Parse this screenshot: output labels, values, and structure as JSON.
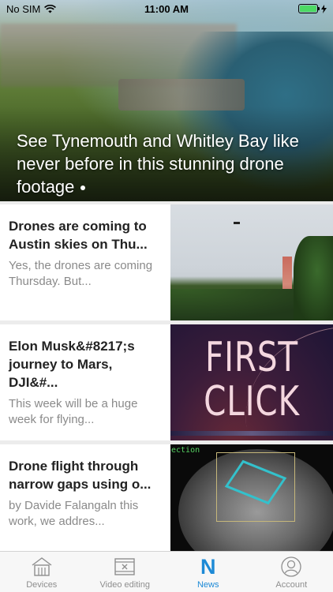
{
  "status_bar": {
    "carrier": "No SIM",
    "time": "11:00 AM"
  },
  "hero": {
    "title": "See Tynemouth and Whitley Bay like never before in this stunning drone footage"
  },
  "articles": [
    {
      "title": "Drones are coming to Austin skies on Thu...",
      "summary": "Yes, the drones are coming Thursday. But..."
    },
    {
      "title": "Elon Musk&#8217;s journey to Mars, DJI&#...",
      "summary": "This week will be a huge week for flying...",
      "thumb_text": "FIRST CLICK"
    },
    {
      "title": "Drone flight through narrow gaps using o...",
      "summary": "by Davide Falangaln this work, we addres...",
      "thumb_text": "ection"
    }
  ],
  "tabs": [
    {
      "label": "Devices",
      "icon": "house-icon",
      "active": false
    },
    {
      "label": "Video editing",
      "icon": "film-icon",
      "active": false
    },
    {
      "label": "News",
      "icon": "news-n-icon",
      "active": true
    },
    {
      "label": "Account",
      "icon": "person-icon",
      "active": false
    }
  ],
  "colors": {
    "accent": "#1d8ad6",
    "battery": "#4cd964",
    "tab_inactive": "#8e8e8e"
  }
}
